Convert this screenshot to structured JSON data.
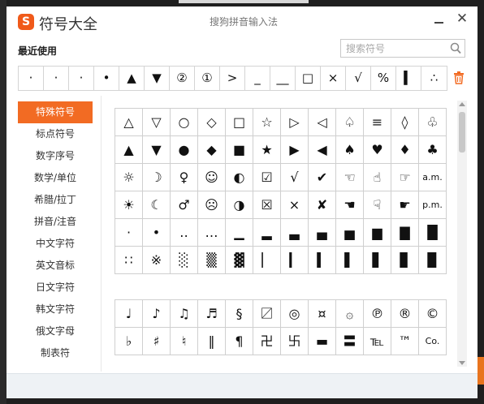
{
  "app": {
    "logo_glyph": "S",
    "title": "符号大全",
    "window_title": "搜狗拼音输入法",
    "close_glyph": "✕"
  },
  "recent": {
    "label": "最近使用",
    "symbols": [
      "·",
      "·",
      "·",
      "•",
      "▲",
      "▼",
      "②",
      "①",
      ">",
      "_",
      "__",
      "□",
      "×",
      "√",
      "%",
      "▍",
      "∴"
    ]
  },
  "search": {
    "placeholder": "搜索符号",
    "value": ""
  },
  "sidebar": {
    "items": [
      {
        "label": "特殊符号",
        "active": true
      },
      {
        "label": "标点符号",
        "active": false
      },
      {
        "label": "数字序号",
        "active": false
      },
      {
        "label": "数学/单位",
        "active": false
      },
      {
        "label": "希腊/拉丁",
        "active": false
      },
      {
        "label": "拼音/注音",
        "active": false
      },
      {
        "label": "中文字符",
        "active": false
      },
      {
        "label": "英文音标",
        "active": false
      },
      {
        "label": "日文字符",
        "active": false
      },
      {
        "label": "韩文字符",
        "active": false
      },
      {
        "label": "俄文字母",
        "active": false
      },
      {
        "label": "制表符",
        "active": false
      }
    ]
  },
  "grid1": {
    "symbols": [
      "△",
      "▽",
      "○",
      "◇",
      "□",
      "☆",
      "▷",
      "◁",
      "♤",
      "≡",
      "◊",
      "♧",
      "▲",
      "▼",
      "●",
      "◆",
      "■",
      "★",
      "▶",
      "◀",
      "♠",
      "♥",
      "♦",
      "♣",
      "☼",
      "☽",
      "♀",
      "☺",
      "◐",
      "☑",
      "√",
      "✔",
      "☜",
      "☝",
      "☞",
      "a.m.",
      "☀",
      "☾",
      "♂",
      "☹",
      "◑",
      "☒",
      "×",
      "✘",
      "☚",
      "☟",
      "☛",
      "p.m.",
      "·",
      "•",
      "‥",
      "…",
      "▁",
      "▂",
      "▃",
      "▄",
      "▅",
      "▆",
      "▇",
      "█",
      "∷",
      "※",
      "░",
      "▒",
      "▓",
      "▏",
      "▎",
      "▍",
      "▌",
      "▋",
      "▊",
      "▉"
    ]
  },
  "grid2": {
    "symbols": [
      "♩",
      "♪",
      "♫",
      "♬",
      "§",
      "〼",
      "◎",
      "¤",
      "۞",
      "℗",
      "®",
      "©",
      "♭",
      "♯",
      "♮",
      "‖",
      "¶",
      "卍",
      "卐",
      "▬",
      "〓",
      "℡",
      "™",
      "Co."
    ]
  },
  "colors": {
    "accent": "#f26b23",
    "logo": "#f05a1a",
    "grid_border": "#cfcfcf",
    "bottom_bar": "#eef2f5"
  },
  "icons": {
    "search": "search-icon",
    "trash": "trash-icon",
    "minimize": "minimize-icon",
    "close": "close-icon"
  }
}
